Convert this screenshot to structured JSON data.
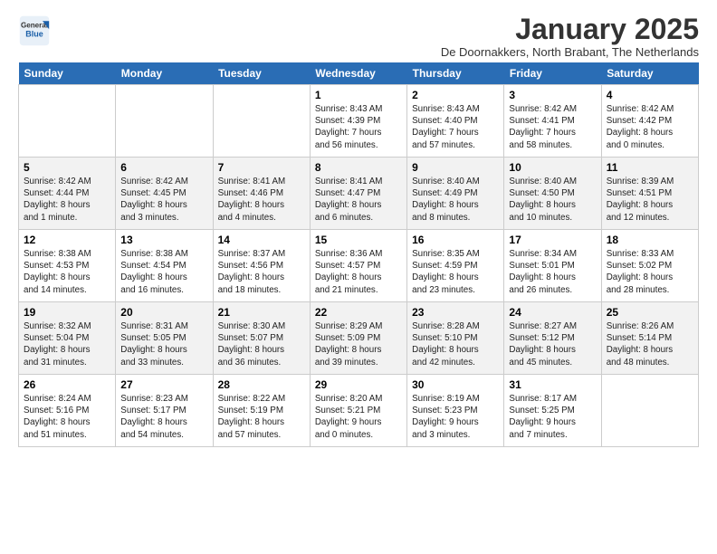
{
  "logo": {
    "text_general": "General",
    "text_blue": "Blue"
  },
  "header": {
    "title": "January 2025",
    "subtitle": "De Doornakkers, North Brabant, The Netherlands"
  },
  "weekdays": [
    "Sunday",
    "Monday",
    "Tuesday",
    "Wednesday",
    "Thursday",
    "Friday",
    "Saturday"
  ],
  "weeks": [
    [
      {
        "day": null,
        "info": ""
      },
      {
        "day": null,
        "info": ""
      },
      {
        "day": null,
        "info": ""
      },
      {
        "day": "1",
        "info": "Sunrise: 8:43 AM\nSunset: 4:39 PM\nDaylight: 7 hours\nand 56 minutes."
      },
      {
        "day": "2",
        "info": "Sunrise: 8:43 AM\nSunset: 4:40 PM\nDaylight: 7 hours\nand 57 minutes."
      },
      {
        "day": "3",
        "info": "Sunrise: 8:42 AM\nSunset: 4:41 PM\nDaylight: 7 hours\nand 58 minutes."
      },
      {
        "day": "4",
        "info": "Sunrise: 8:42 AM\nSunset: 4:42 PM\nDaylight: 8 hours\nand 0 minutes."
      }
    ],
    [
      {
        "day": "5",
        "info": "Sunrise: 8:42 AM\nSunset: 4:44 PM\nDaylight: 8 hours\nand 1 minute."
      },
      {
        "day": "6",
        "info": "Sunrise: 8:42 AM\nSunset: 4:45 PM\nDaylight: 8 hours\nand 3 minutes."
      },
      {
        "day": "7",
        "info": "Sunrise: 8:41 AM\nSunset: 4:46 PM\nDaylight: 8 hours\nand 4 minutes."
      },
      {
        "day": "8",
        "info": "Sunrise: 8:41 AM\nSunset: 4:47 PM\nDaylight: 8 hours\nand 6 minutes."
      },
      {
        "day": "9",
        "info": "Sunrise: 8:40 AM\nSunset: 4:49 PM\nDaylight: 8 hours\nand 8 minutes."
      },
      {
        "day": "10",
        "info": "Sunrise: 8:40 AM\nSunset: 4:50 PM\nDaylight: 8 hours\nand 10 minutes."
      },
      {
        "day": "11",
        "info": "Sunrise: 8:39 AM\nSunset: 4:51 PM\nDaylight: 8 hours\nand 12 minutes."
      }
    ],
    [
      {
        "day": "12",
        "info": "Sunrise: 8:38 AM\nSunset: 4:53 PM\nDaylight: 8 hours\nand 14 minutes."
      },
      {
        "day": "13",
        "info": "Sunrise: 8:38 AM\nSunset: 4:54 PM\nDaylight: 8 hours\nand 16 minutes."
      },
      {
        "day": "14",
        "info": "Sunrise: 8:37 AM\nSunset: 4:56 PM\nDaylight: 8 hours\nand 18 minutes."
      },
      {
        "day": "15",
        "info": "Sunrise: 8:36 AM\nSunset: 4:57 PM\nDaylight: 8 hours\nand 21 minutes."
      },
      {
        "day": "16",
        "info": "Sunrise: 8:35 AM\nSunset: 4:59 PM\nDaylight: 8 hours\nand 23 minutes."
      },
      {
        "day": "17",
        "info": "Sunrise: 8:34 AM\nSunset: 5:01 PM\nDaylight: 8 hours\nand 26 minutes."
      },
      {
        "day": "18",
        "info": "Sunrise: 8:33 AM\nSunset: 5:02 PM\nDaylight: 8 hours\nand 28 minutes."
      }
    ],
    [
      {
        "day": "19",
        "info": "Sunrise: 8:32 AM\nSunset: 5:04 PM\nDaylight: 8 hours\nand 31 minutes."
      },
      {
        "day": "20",
        "info": "Sunrise: 8:31 AM\nSunset: 5:05 PM\nDaylight: 8 hours\nand 33 minutes."
      },
      {
        "day": "21",
        "info": "Sunrise: 8:30 AM\nSunset: 5:07 PM\nDaylight: 8 hours\nand 36 minutes."
      },
      {
        "day": "22",
        "info": "Sunrise: 8:29 AM\nSunset: 5:09 PM\nDaylight: 8 hours\nand 39 minutes."
      },
      {
        "day": "23",
        "info": "Sunrise: 8:28 AM\nSunset: 5:10 PM\nDaylight: 8 hours\nand 42 minutes."
      },
      {
        "day": "24",
        "info": "Sunrise: 8:27 AM\nSunset: 5:12 PM\nDaylight: 8 hours\nand 45 minutes."
      },
      {
        "day": "25",
        "info": "Sunrise: 8:26 AM\nSunset: 5:14 PM\nDaylight: 8 hours\nand 48 minutes."
      }
    ],
    [
      {
        "day": "26",
        "info": "Sunrise: 8:24 AM\nSunset: 5:16 PM\nDaylight: 8 hours\nand 51 minutes."
      },
      {
        "day": "27",
        "info": "Sunrise: 8:23 AM\nSunset: 5:17 PM\nDaylight: 8 hours\nand 54 minutes."
      },
      {
        "day": "28",
        "info": "Sunrise: 8:22 AM\nSunset: 5:19 PM\nDaylight: 8 hours\nand 57 minutes."
      },
      {
        "day": "29",
        "info": "Sunrise: 8:20 AM\nSunset: 5:21 PM\nDaylight: 9 hours\nand 0 minutes."
      },
      {
        "day": "30",
        "info": "Sunrise: 8:19 AM\nSunset: 5:23 PM\nDaylight: 9 hours\nand 3 minutes."
      },
      {
        "day": "31",
        "info": "Sunrise: 8:17 AM\nSunset: 5:25 PM\nDaylight: 9 hours\nand 7 minutes."
      },
      {
        "day": null,
        "info": ""
      }
    ]
  ]
}
